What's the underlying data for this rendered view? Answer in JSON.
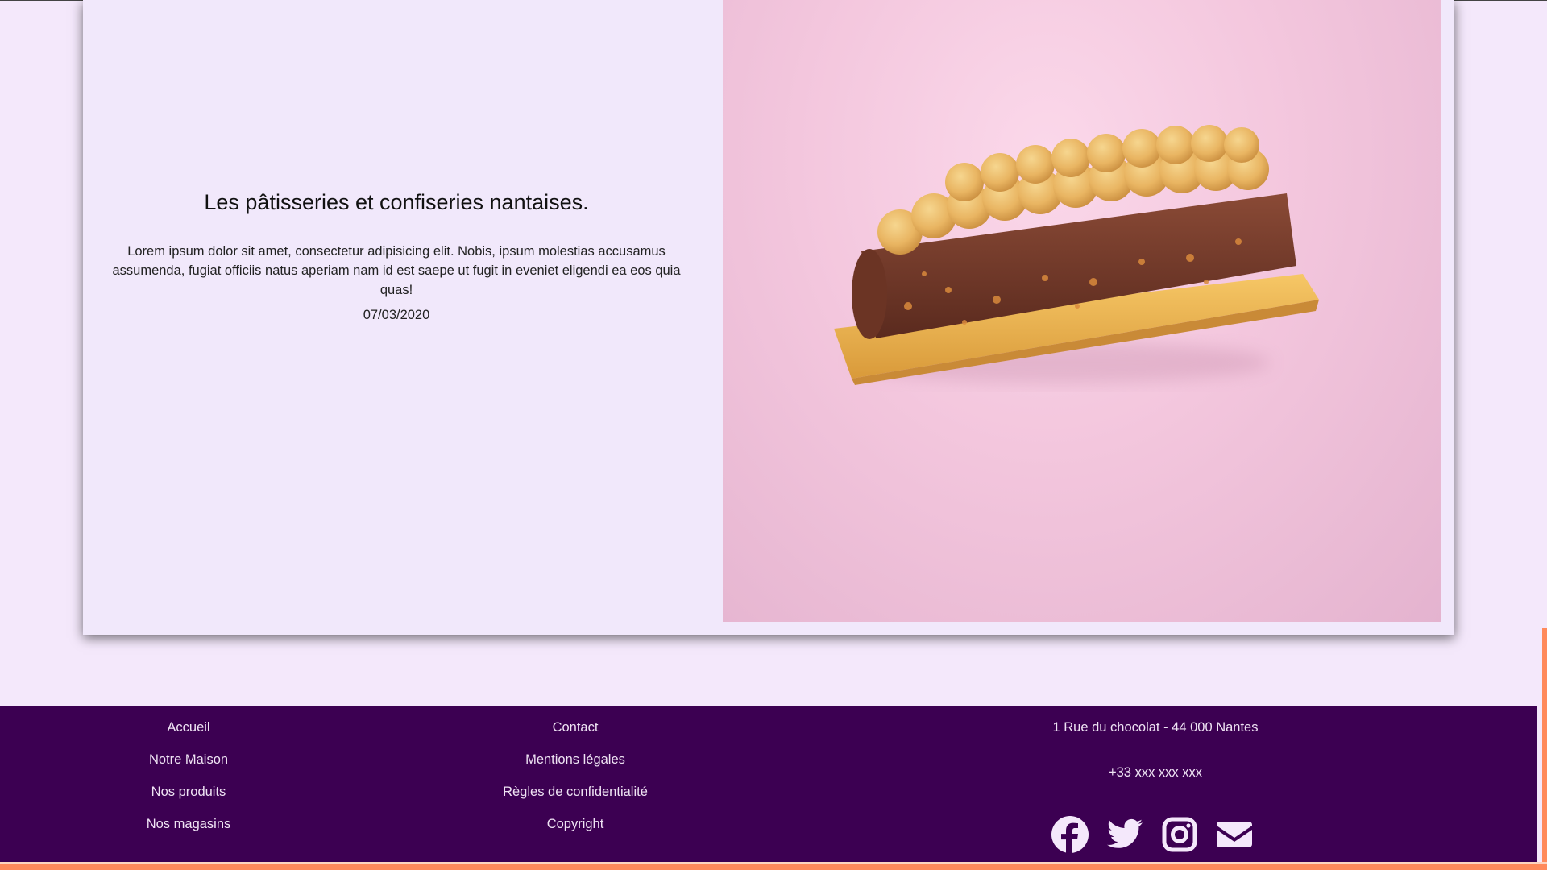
{
  "article": {
    "title": "Les pâtisseries et confiseries nantaises.",
    "description": "Lorem ipsum dolor sit amet, consectetur adipisicing elit. Nobis, ipsum molestias accusamus assumenda, fugiat officiis natus aperiam nam id est saepe ut fugit in eveniet eligendi ea eos quia quas!",
    "date": "07/03/2020",
    "image_icon": "eclair-pastry-photo"
  },
  "footer": {
    "nav": [
      "Accueil",
      "Notre Maison",
      "Nos produits",
      "Nos magasins"
    ],
    "legal": [
      "Contact",
      "Mentions légales",
      "Règles de confidentialité",
      "Copyright"
    ],
    "address": "1 Rue du chocolat - 44 000 Nantes",
    "phone": "+33 xxx xxx xxx",
    "socials": [
      "facebook-icon",
      "twitter-icon",
      "instagram-icon",
      "envelope-icon"
    ]
  },
  "colors": {
    "page_bg": "#f4e8fb",
    "footer_bg": "#3c0052",
    "accent": "#ff8a5b"
  }
}
